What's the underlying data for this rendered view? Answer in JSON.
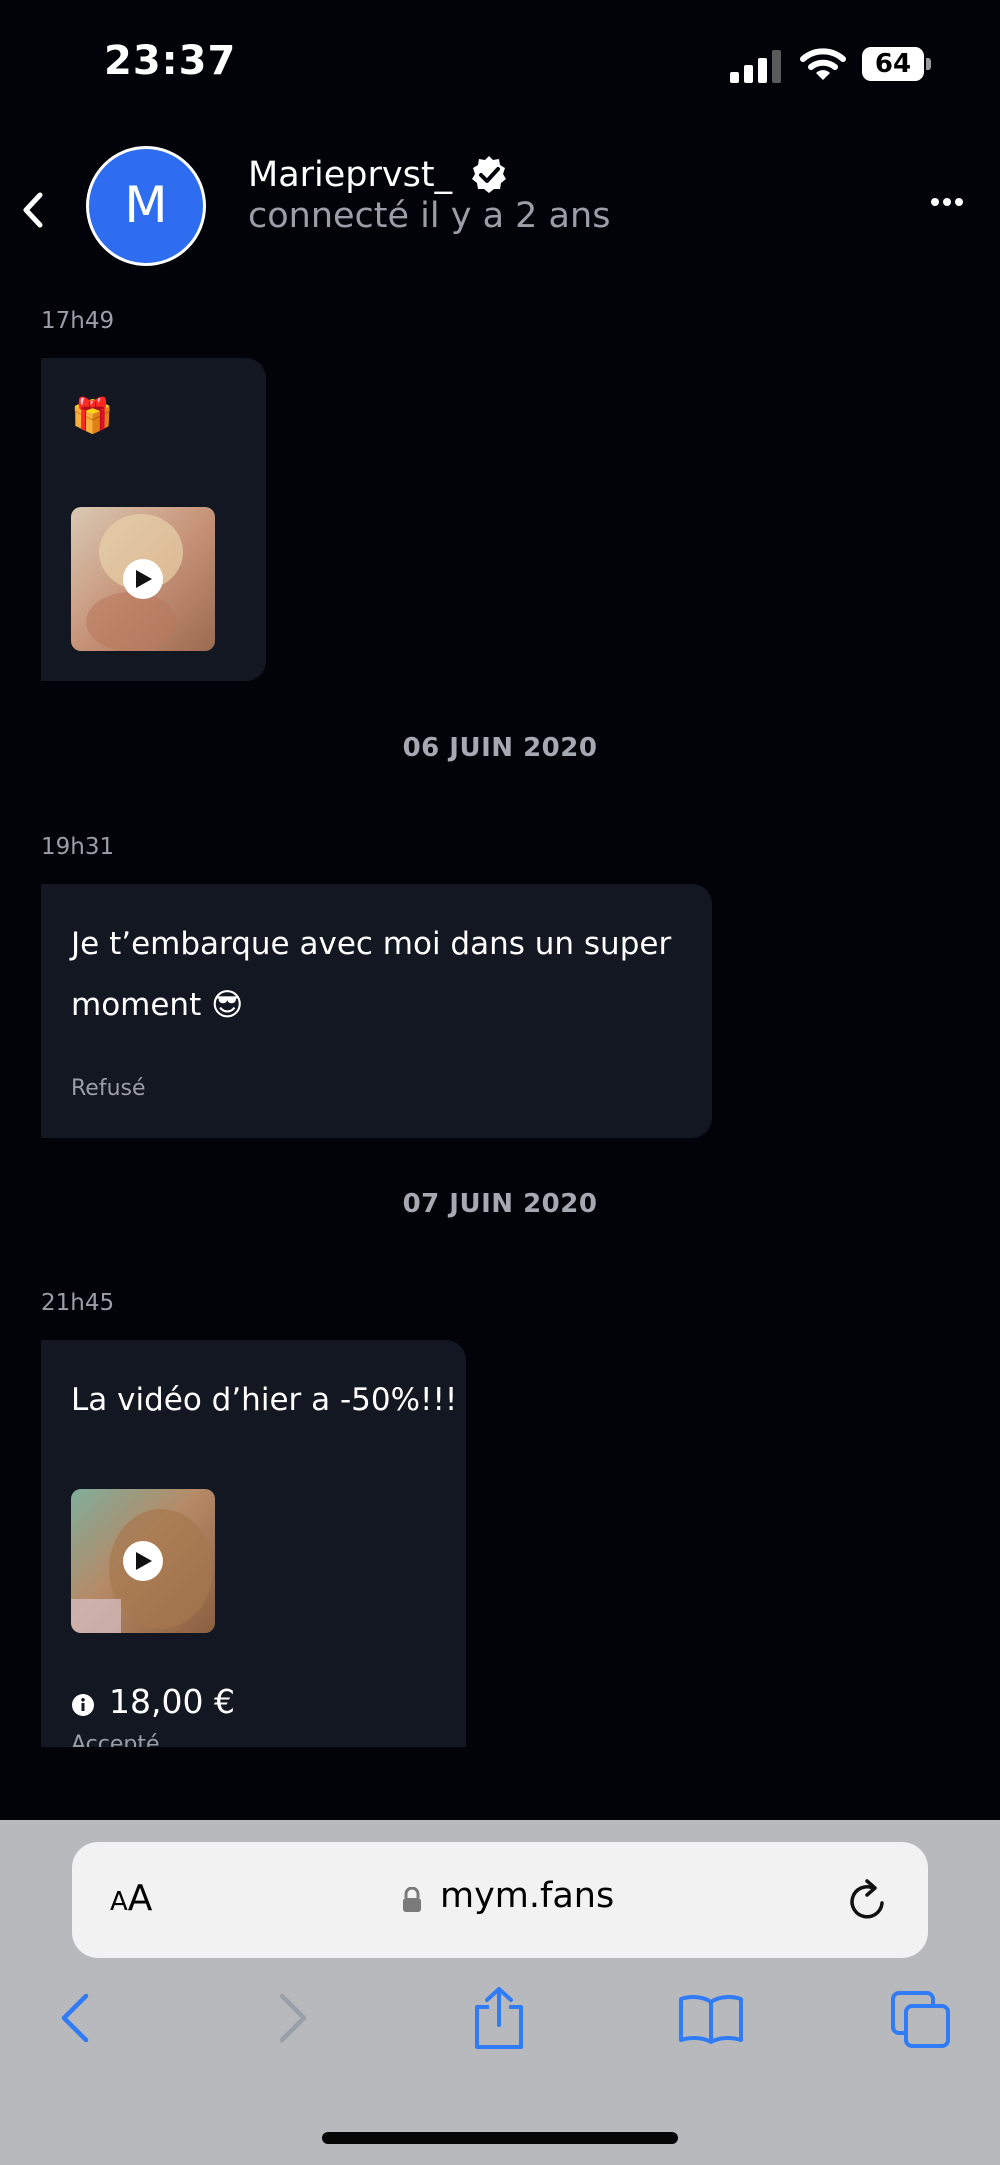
{
  "status_bar": {
    "time": "23:37",
    "battery": "64"
  },
  "header": {
    "avatar_initial": "M",
    "username": "Marieprvst_",
    "last_seen": "connecté il y a 2 ans"
  },
  "messages": [
    {
      "time": "17h49",
      "text": "🎁"
    },
    {
      "date_separator": "06 JUIN 2020",
      "time": "19h31",
      "text_line1": "Je t’embarque avec moi dans un super",
      "text_line2": "moment 😎",
      "status": "Refusé"
    },
    {
      "date_separator": "07 JUIN 2020",
      "time": "21h45",
      "text": "La vidéo d’hier a -50%!!!",
      "price": "18,00 €",
      "status": "Accepté"
    }
  ],
  "safari": {
    "aa_label_small": "A",
    "aa_label_large": "A",
    "url": "mym.fans"
  },
  "colors": {
    "background": "#020308",
    "bubble": "#131722",
    "avatar": "#2f6df0",
    "safari_toolbar": "#b8b9bc",
    "ios_blue": "#2f7cf6"
  },
  "icons": [
    "back-chevron-icon",
    "verified-badge-icon",
    "more-icon",
    "play-icon",
    "info-icon",
    "lock-icon",
    "reload-icon",
    "safari-back-icon",
    "safari-forward-icon",
    "share-icon",
    "bookmarks-icon",
    "tabs-icon"
  ]
}
